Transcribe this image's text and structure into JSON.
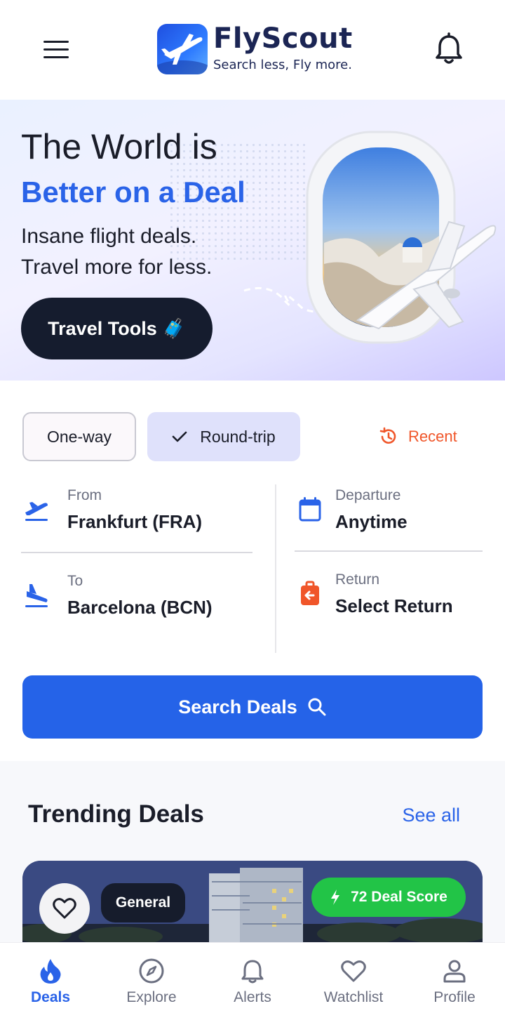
{
  "header": {
    "logo_title": "FlyScout",
    "logo_tagline": "Search less, Fly more."
  },
  "hero": {
    "line1": "The World is",
    "line2": "Better on a Deal",
    "sub1": "Insane flight deals.",
    "sub2": "Travel more for less.",
    "tools_button": "Travel Tools 🧳"
  },
  "search": {
    "trip_types": [
      "One-way",
      "Round-trip"
    ],
    "selected_trip_type": "Round-trip",
    "recent_label": "Recent",
    "from_label": "From",
    "from_value": "Frankfurt (FRA)",
    "to_label": "To",
    "to_value": "Barcelona (BCN)",
    "departure_label": "Departure",
    "departure_value": "Anytime",
    "return_label": "Return",
    "return_value": "Select Return",
    "search_button": "Search Deals"
  },
  "trending": {
    "title": "Trending Deals",
    "see_all": "See all",
    "deal": {
      "category": "General",
      "deal_score": "72 Deal Score"
    }
  },
  "nav": {
    "items": [
      {
        "label": "Deals",
        "icon": "flame-icon",
        "active": true
      },
      {
        "label": "Explore",
        "icon": "compass-icon",
        "active": false
      },
      {
        "label": "Alerts",
        "icon": "bell-icon",
        "active": false
      },
      {
        "label": "Watchlist",
        "icon": "heart-icon",
        "active": false
      },
      {
        "label": "Profile",
        "icon": "person-icon",
        "active": false
      }
    ]
  },
  "colors": {
    "accent": "#2563e8",
    "recent": "#f0562a",
    "score_badge": "#22c447",
    "dark": "#151c2e"
  }
}
